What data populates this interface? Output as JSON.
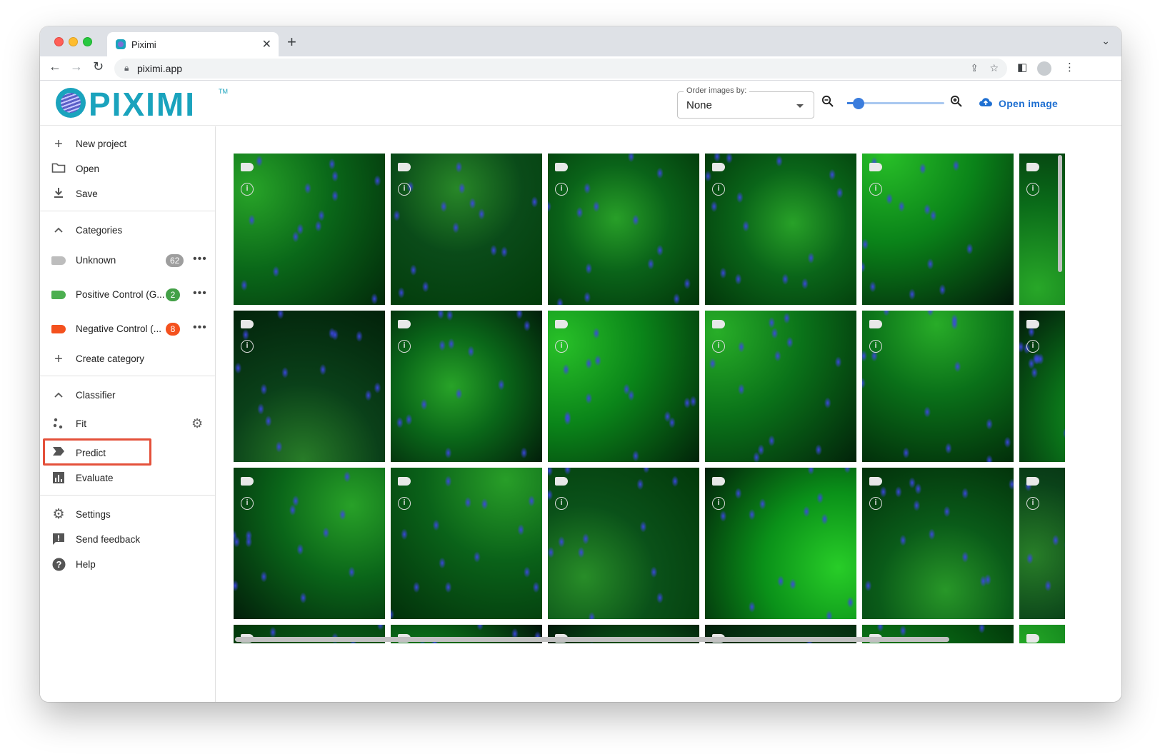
{
  "browser": {
    "tab_title": "Piximi",
    "url": "piximi.app"
  },
  "header": {
    "logo_text": "PIXIMI",
    "logo_tm": "TM",
    "order_label": "Order images by:",
    "order_value": "None",
    "zoom_level_fraction": 0.12,
    "open_image_label": "Open image"
  },
  "sidebar": {
    "file_items": [
      {
        "label": "New project",
        "icon": "plus-icon"
      },
      {
        "label": "Open",
        "icon": "folder-icon"
      },
      {
        "label": "Save",
        "icon": "download-icon"
      }
    ],
    "categories": {
      "header": "Categories",
      "items": [
        {
          "label": "Unknown",
          "count": "62",
          "color": "#bdbdbd"
        },
        {
          "label": "Positive Control (G...",
          "count": "2",
          "color": "#4caf50"
        },
        {
          "label": "Negative Control (...",
          "count": "8",
          "color": "#f4511e"
        }
      ],
      "create_label": "Create category"
    },
    "classifier": {
      "header": "Classifier",
      "fit_label": "Fit",
      "predict_label": "Predict",
      "evaluate_label": "Evaluate"
    },
    "footer_items": [
      {
        "label": "Settings",
        "icon": "gear-icon"
      },
      {
        "label": "Send feedback",
        "icon": "feedback-icon"
      },
      {
        "label": "Help",
        "icon": "help-icon"
      }
    ]
  },
  "grid": {
    "rows": 4,
    "columns": 6,
    "image_count": 24
  },
  "colors": {
    "brand": "#1aa3bd",
    "accent": "#1e6fd1",
    "highlight": "#e4503a"
  }
}
